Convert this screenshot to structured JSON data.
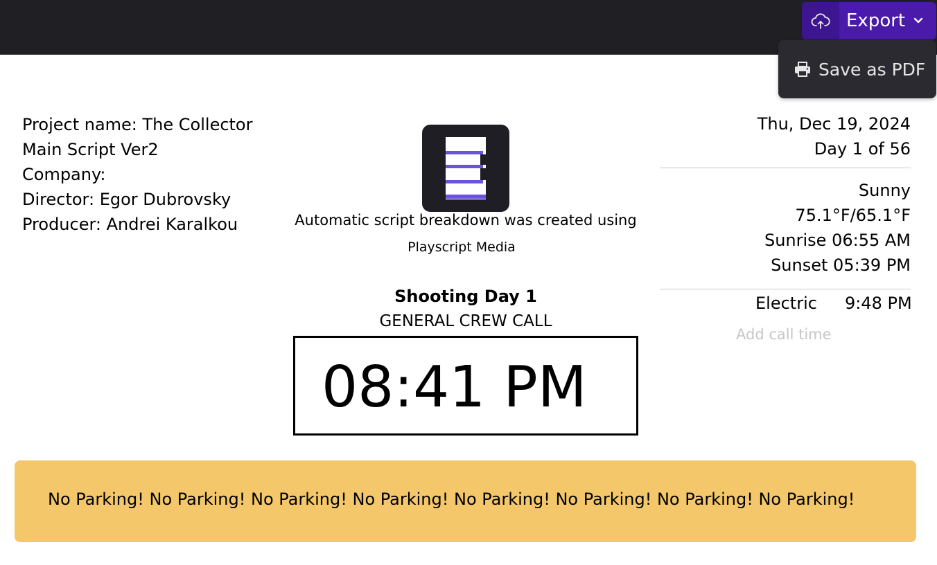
{
  "header": {
    "export_label": "Export",
    "dropdown_item_label": "Save as PDF",
    "accent_color": "#4a1aa8"
  },
  "project": {
    "name_line": "Project name: The Collector",
    "script_line": "Main Script Ver2",
    "company_line": "Company:",
    "director_line": "Director: Egor Dubrovsky",
    "producer_line": "Producer: Andrei Karalkou"
  },
  "branding": {
    "caption_line1": "Automatic script breakdown was created using",
    "caption_line2": "Playscript Media",
    "logo_icon": "playscript-logo-icon"
  },
  "shooting": {
    "title": "Shooting Day 1",
    "crew_call_label": "GENERAL CREW CALL",
    "crew_call_time": "08:41 PM"
  },
  "date_info": {
    "date": "Thu, Dec 19, 2024",
    "day_count": "Day 1 of 56"
  },
  "weather": {
    "condition": "Sunny",
    "temps": "75.1°F/65.1°F",
    "sunrise": "Sunrise 06:55 AM",
    "sunset": "Sunset 05:39 PM"
  },
  "call_times": {
    "department": "Electric",
    "time": "9:48 PM",
    "add_placeholder": "Add call time"
  },
  "notice": {
    "text": "No Parking! No Parking! No Parking! No Parking! No Parking! No Parking! No Parking! No Parking!",
    "color": "#f4c86a"
  }
}
